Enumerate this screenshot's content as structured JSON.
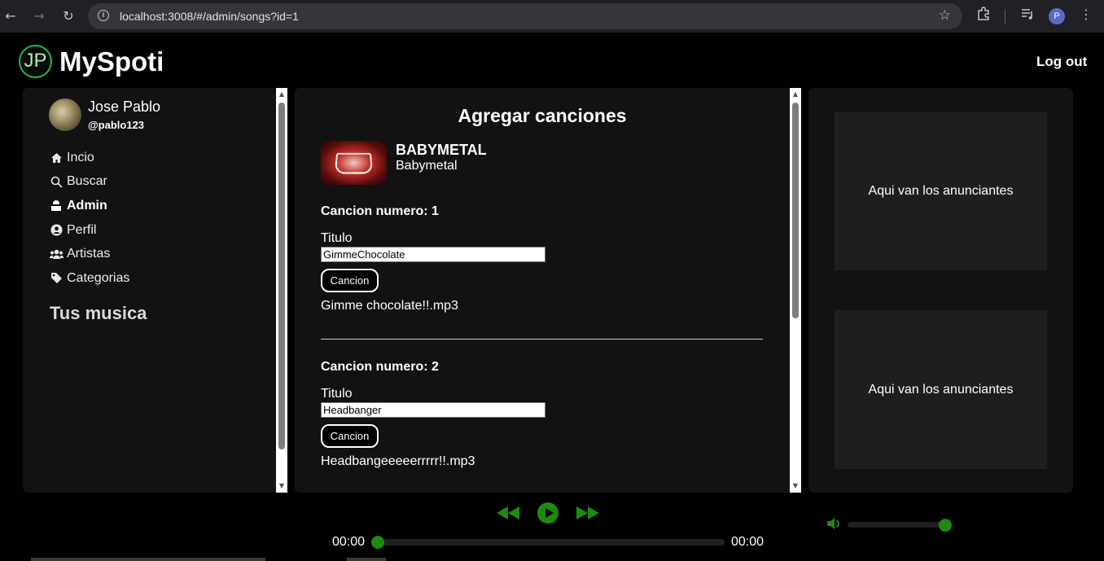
{
  "browser": {
    "url": "localhost:3008/#/admin/songs?id=1",
    "profile_initial": "P"
  },
  "header": {
    "logo_text": "JP",
    "app_name": "MySpoti",
    "logout_label": "Log out"
  },
  "sidebar": {
    "user": {
      "name": "Jose Pablo",
      "handle": "@pablo123"
    },
    "nav": [
      {
        "label": "Incio",
        "icon": "home-icon",
        "active": false
      },
      {
        "label": "Buscar",
        "icon": "search-icon",
        "active": false
      },
      {
        "label": "Admin",
        "icon": "admin-icon",
        "active": true
      },
      {
        "label": "Perfil",
        "icon": "user-circle-icon",
        "active": false
      },
      {
        "label": "Artistas",
        "icon": "users-icon",
        "active": false
      },
      {
        "label": "Categorias",
        "icon": "tag-icon",
        "active": false
      }
    ],
    "section_title": "Tus musica"
  },
  "main": {
    "title": "Agregar canciones",
    "album": {
      "title": "BABYMETAL",
      "artist": "Babymetal"
    },
    "songs": [
      {
        "heading": "Cancion numero: 1",
        "title_label": "Titulo",
        "title_value": "GimmeChocolate",
        "button_label": "Cancion",
        "file_name": "Gimme chocolate!!.mp3"
      },
      {
        "heading": "Cancion numero: 2",
        "title_label": "Titulo",
        "title_value": "Headbanger",
        "button_label": "Cancion",
        "file_name": "Headbangeeeeerrrrr!!.mp3"
      }
    ]
  },
  "ads": {
    "items": [
      "Aqui van los anunciantes",
      "Aqui van los anunciantes"
    ]
  },
  "player": {
    "current_time": "00:00",
    "total_time": "00:00",
    "progress": 0,
    "volume": 1.0,
    "accent_color": "#1e8a10"
  }
}
